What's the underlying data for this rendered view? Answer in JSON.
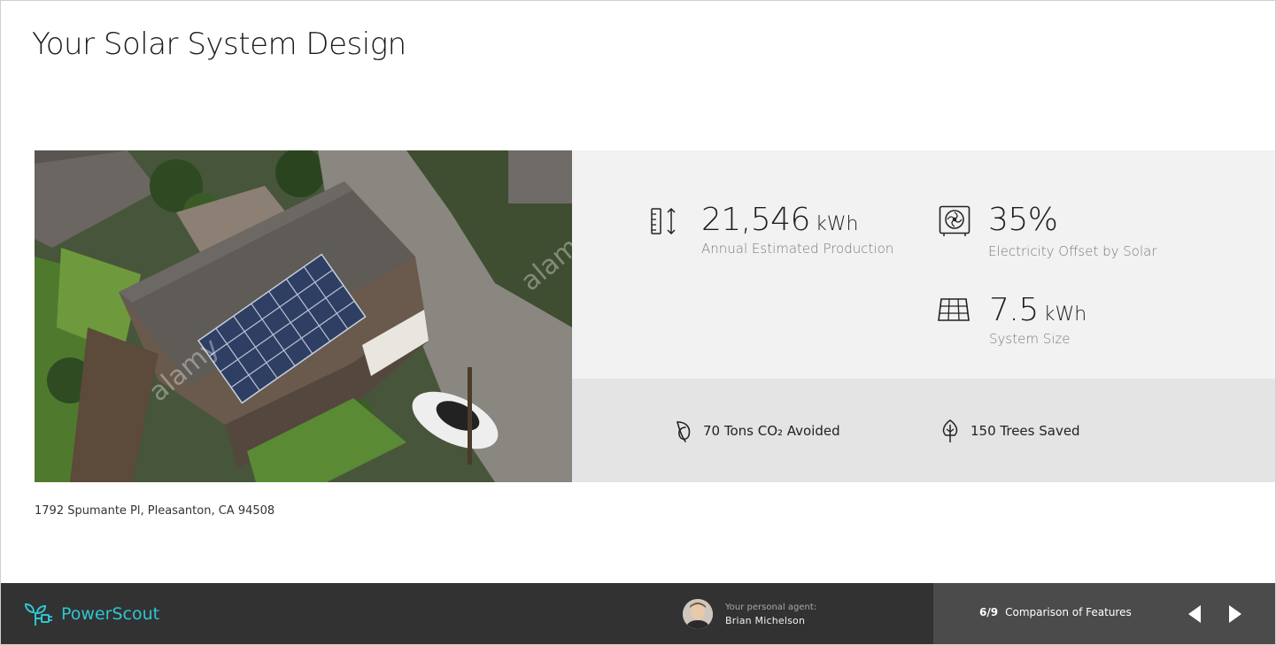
{
  "page": {
    "title": "Your Solar System Design"
  },
  "photo": {
    "watermark": "alamy"
  },
  "stats": {
    "production": {
      "value": "21,546",
      "unit": "kWh",
      "label": "Annual Estimated Production",
      "icon": "ruler-arrows-icon"
    },
    "offset": {
      "value": "35%",
      "label": "Electricity Offset by Solar",
      "icon": "electric-meter-icon"
    },
    "system_size": {
      "value": "7.5",
      "unit": "kWh",
      "label": "System Size",
      "icon": "solar-panel-icon"
    }
  },
  "impact": {
    "co2": {
      "text": "70 Tons CO₂  Avoided",
      "icon": "leaf-icon"
    },
    "trees": {
      "text": "150 Trees Saved",
      "icon": "tree-icon"
    }
  },
  "address": "1792 Spumante Pl, Pleasanton, CA 94508",
  "footer": {
    "brand": "PowerScout",
    "brand_color": "#2ec6d3",
    "agent_caption": "Your personal agent:",
    "agent_name": "Brian Michelson",
    "progress_count": "6/9",
    "progress_label": "Comparison of Features",
    "prev_icon": "triangle-left-icon",
    "next_icon": "triangle-right-icon"
  }
}
